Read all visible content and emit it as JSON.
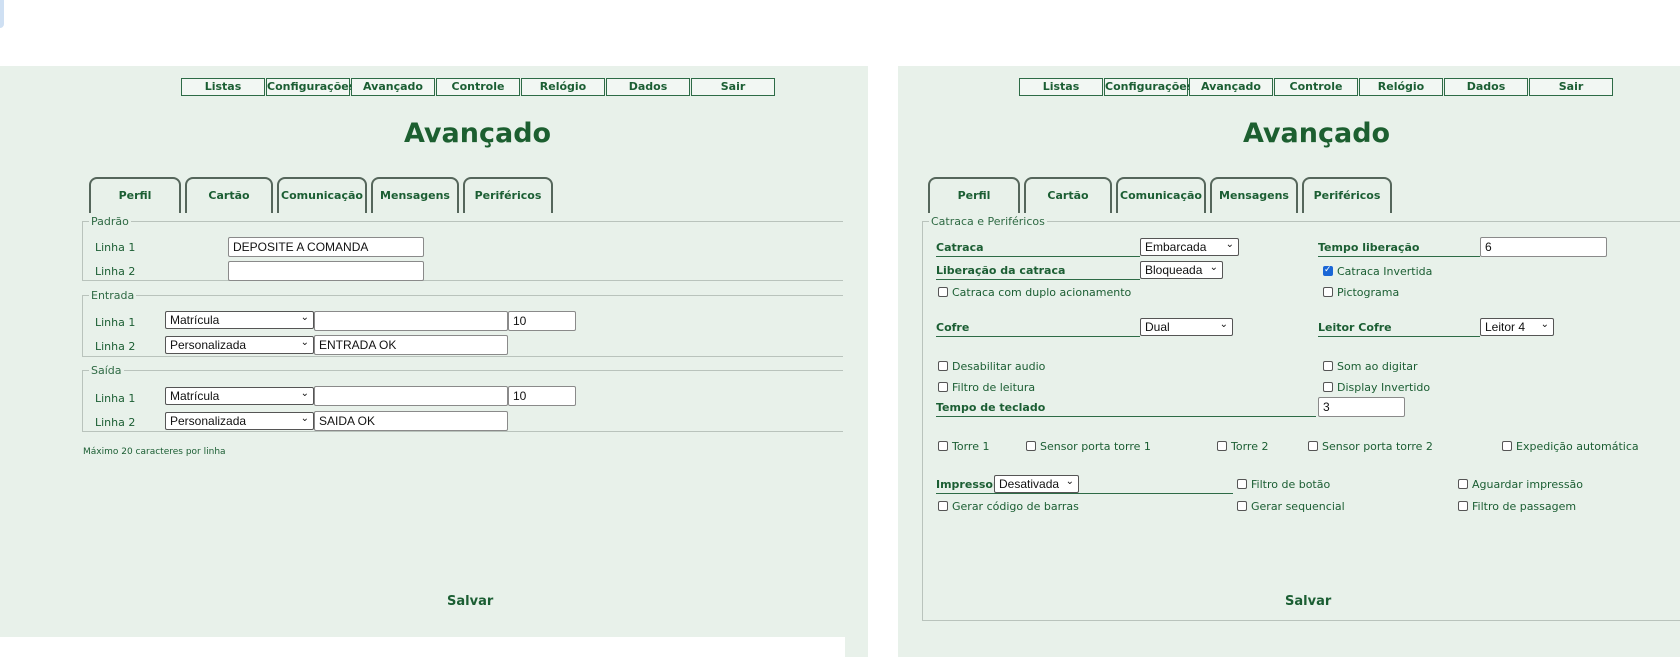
{
  "menu": [
    "Listas",
    "Configurações",
    "Avançado",
    "Controle",
    "Relógio",
    "Dados",
    "Sair"
  ],
  "page_title": "Avançado",
  "tabs": [
    "Perfil",
    "Cartão",
    "Comunicação",
    "Mensagens",
    "Periféricos"
  ],
  "save_label": "Salvar",
  "left": {
    "padrao": {
      "legend": "Padrão",
      "linha1_label": "Linha 1",
      "linha1_value": "DEPOSITE A COMANDA",
      "linha2_label": "Linha 2",
      "linha2_value": ""
    },
    "entrada": {
      "legend": "Entrada",
      "linha1_label": "Linha 1",
      "linha1_select": "Matrícula",
      "linha1_text": "",
      "linha1_num": "10",
      "linha2_label": "Linha 2",
      "linha2_select": "Personalizada",
      "linha2_text": "ENTRADA OK"
    },
    "saida": {
      "legend": "Saída",
      "linha1_label": "Linha 1",
      "linha1_select": "Matrícula",
      "linha1_text": "",
      "linha1_num": "10",
      "linha2_label": "Linha 2",
      "linha2_select": "Personalizada",
      "linha2_text": "SAIDA OK"
    },
    "note": "Máximo 20 caracteres por linha"
  },
  "right": {
    "legend": "Catraca e Periféricos",
    "catraca_label": "Catraca",
    "catraca_value": "Embarcada",
    "tempo_liberacao_label": "Tempo liberação",
    "tempo_liberacao_value": "6",
    "liberacao_label": "Liberação da catraca",
    "liberacao_value": "Bloqueada",
    "catraca_invertida": "Catraca Invertida",
    "duplo_acionamento": "Catraca com duplo acionamento",
    "pictograma": "Pictograma",
    "cofre_label": "Cofre",
    "cofre_value": "Dual",
    "leitor_cofre_label": "Leitor Cofre",
    "leitor_cofre_value": "Leitor 4",
    "desabilitar_audio": "Desabilitar audio",
    "som_digitar": "Som ao digitar",
    "filtro_leitura": "Filtro de leitura",
    "display_invertido": "Display Invertido",
    "tempo_teclado_label": "Tempo de teclado",
    "tempo_teclado_value": "3",
    "torre1": "Torre 1",
    "sensor_torre1": "Sensor porta torre 1",
    "torre2": "Torre 2",
    "sensor_torre2": "Sensor porta torre 2",
    "expedicao": "Expedição automática",
    "impressora_label": "Impressora",
    "impressora_value": "Desativada",
    "filtro_botao": "Filtro de botão",
    "aguardar_impressao": "Aguardar impressão",
    "codigo_barras": "Gerar código de barras",
    "sequencial": "Gerar sequencial",
    "filtro_passagem": "Filtro de passagem"
  }
}
